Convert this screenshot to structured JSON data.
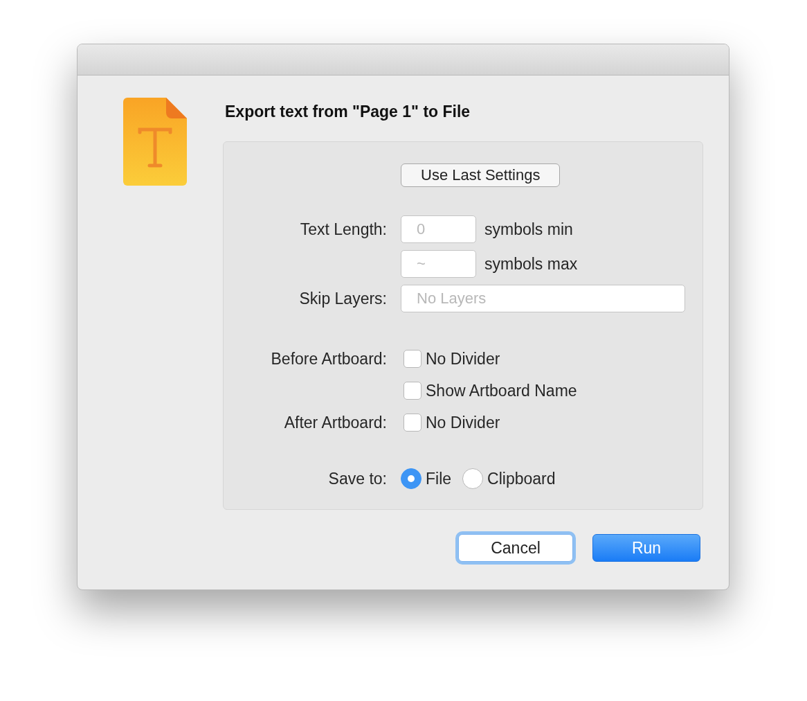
{
  "dialog": {
    "title": "Export text from \"Page 1\" to File"
  },
  "use_last_settings_button": "Use Last Settings",
  "text_length": {
    "label": "Text Length:",
    "fields": [
      {
        "placeholder": "0",
        "suffix": "symbols min"
      },
      {
        "placeholder": "~",
        "suffix": "symbols max"
      }
    ]
  },
  "skip_layers": {
    "label": "Skip Layers:",
    "placeholder": "No Layers"
  },
  "before_artboard": {
    "label": "Before Artboard:",
    "options": [
      {
        "label": "No Divider",
        "checked": false
      },
      {
        "label": "Show Artboard Name",
        "checked": false
      }
    ]
  },
  "after_artboard": {
    "label": "After Artboard:",
    "options": [
      {
        "label": "No Divider",
        "checked": false
      }
    ]
  },
  "save_to": {
    "label": "Save to:",
    "options": [
      {
        "label": "File",
        "selected": true
      },
      {
        "label": "Clipboard",
        "selected": false
      }
    ]
  },
  "buttons": [
    {
      "label": "Cancel",
      "kind": "secondary",
      "focused": true
    },
    {
      "label": "Run",
      "kind": "primary",
      "focused": false
    }
  ]
}
